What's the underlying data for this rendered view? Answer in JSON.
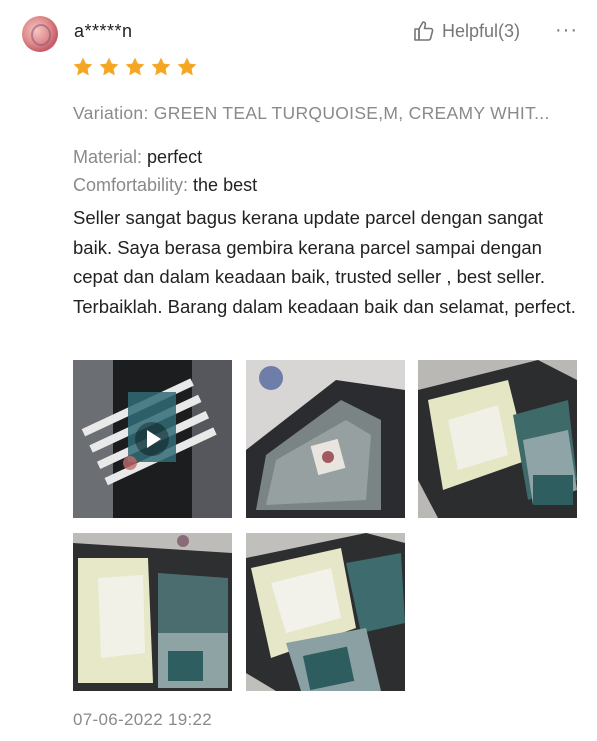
{
  "review": {
    "username": "a*****n",
    "rating": 5,
    "helpful_label": "Helpful(3)",
    "more_label": "···",
    "variation": "Variation: GREEN TEAL TURQUOISE,M, CREAMY WHIT...",
    "material_key": "Material:",
    "material_value": "perfect",
    "comfort_key": "Comfortability:",
    "comfort_value": "the best",
    "comment": "Seller sangat bagus kerana update parcel dengan sangat baik. Saya berasa gembira kerana parcel sampai dengan cepat dan dalam keadaan baik, trusted seller , best seller. Terbaiklah. Barang dalam keadaan baik dan selamat, perfect.",
    "timestamp": "07-06-2022 19:22"
  },
  "media": [
    {
      "kind": "video",
      "icon": "play-icon"
    },
    {
      "kind": "photo"
    },
    {
      "kind": "photo"
    },
    {
      "kind": "photo"
    },
    {
      "kind": "photo"
    }
  ],
  "colors": {
    "star": "#f5a623",
    "muted_text": "#8a8a8a",
    "body_text": "#222222"
  }
}
